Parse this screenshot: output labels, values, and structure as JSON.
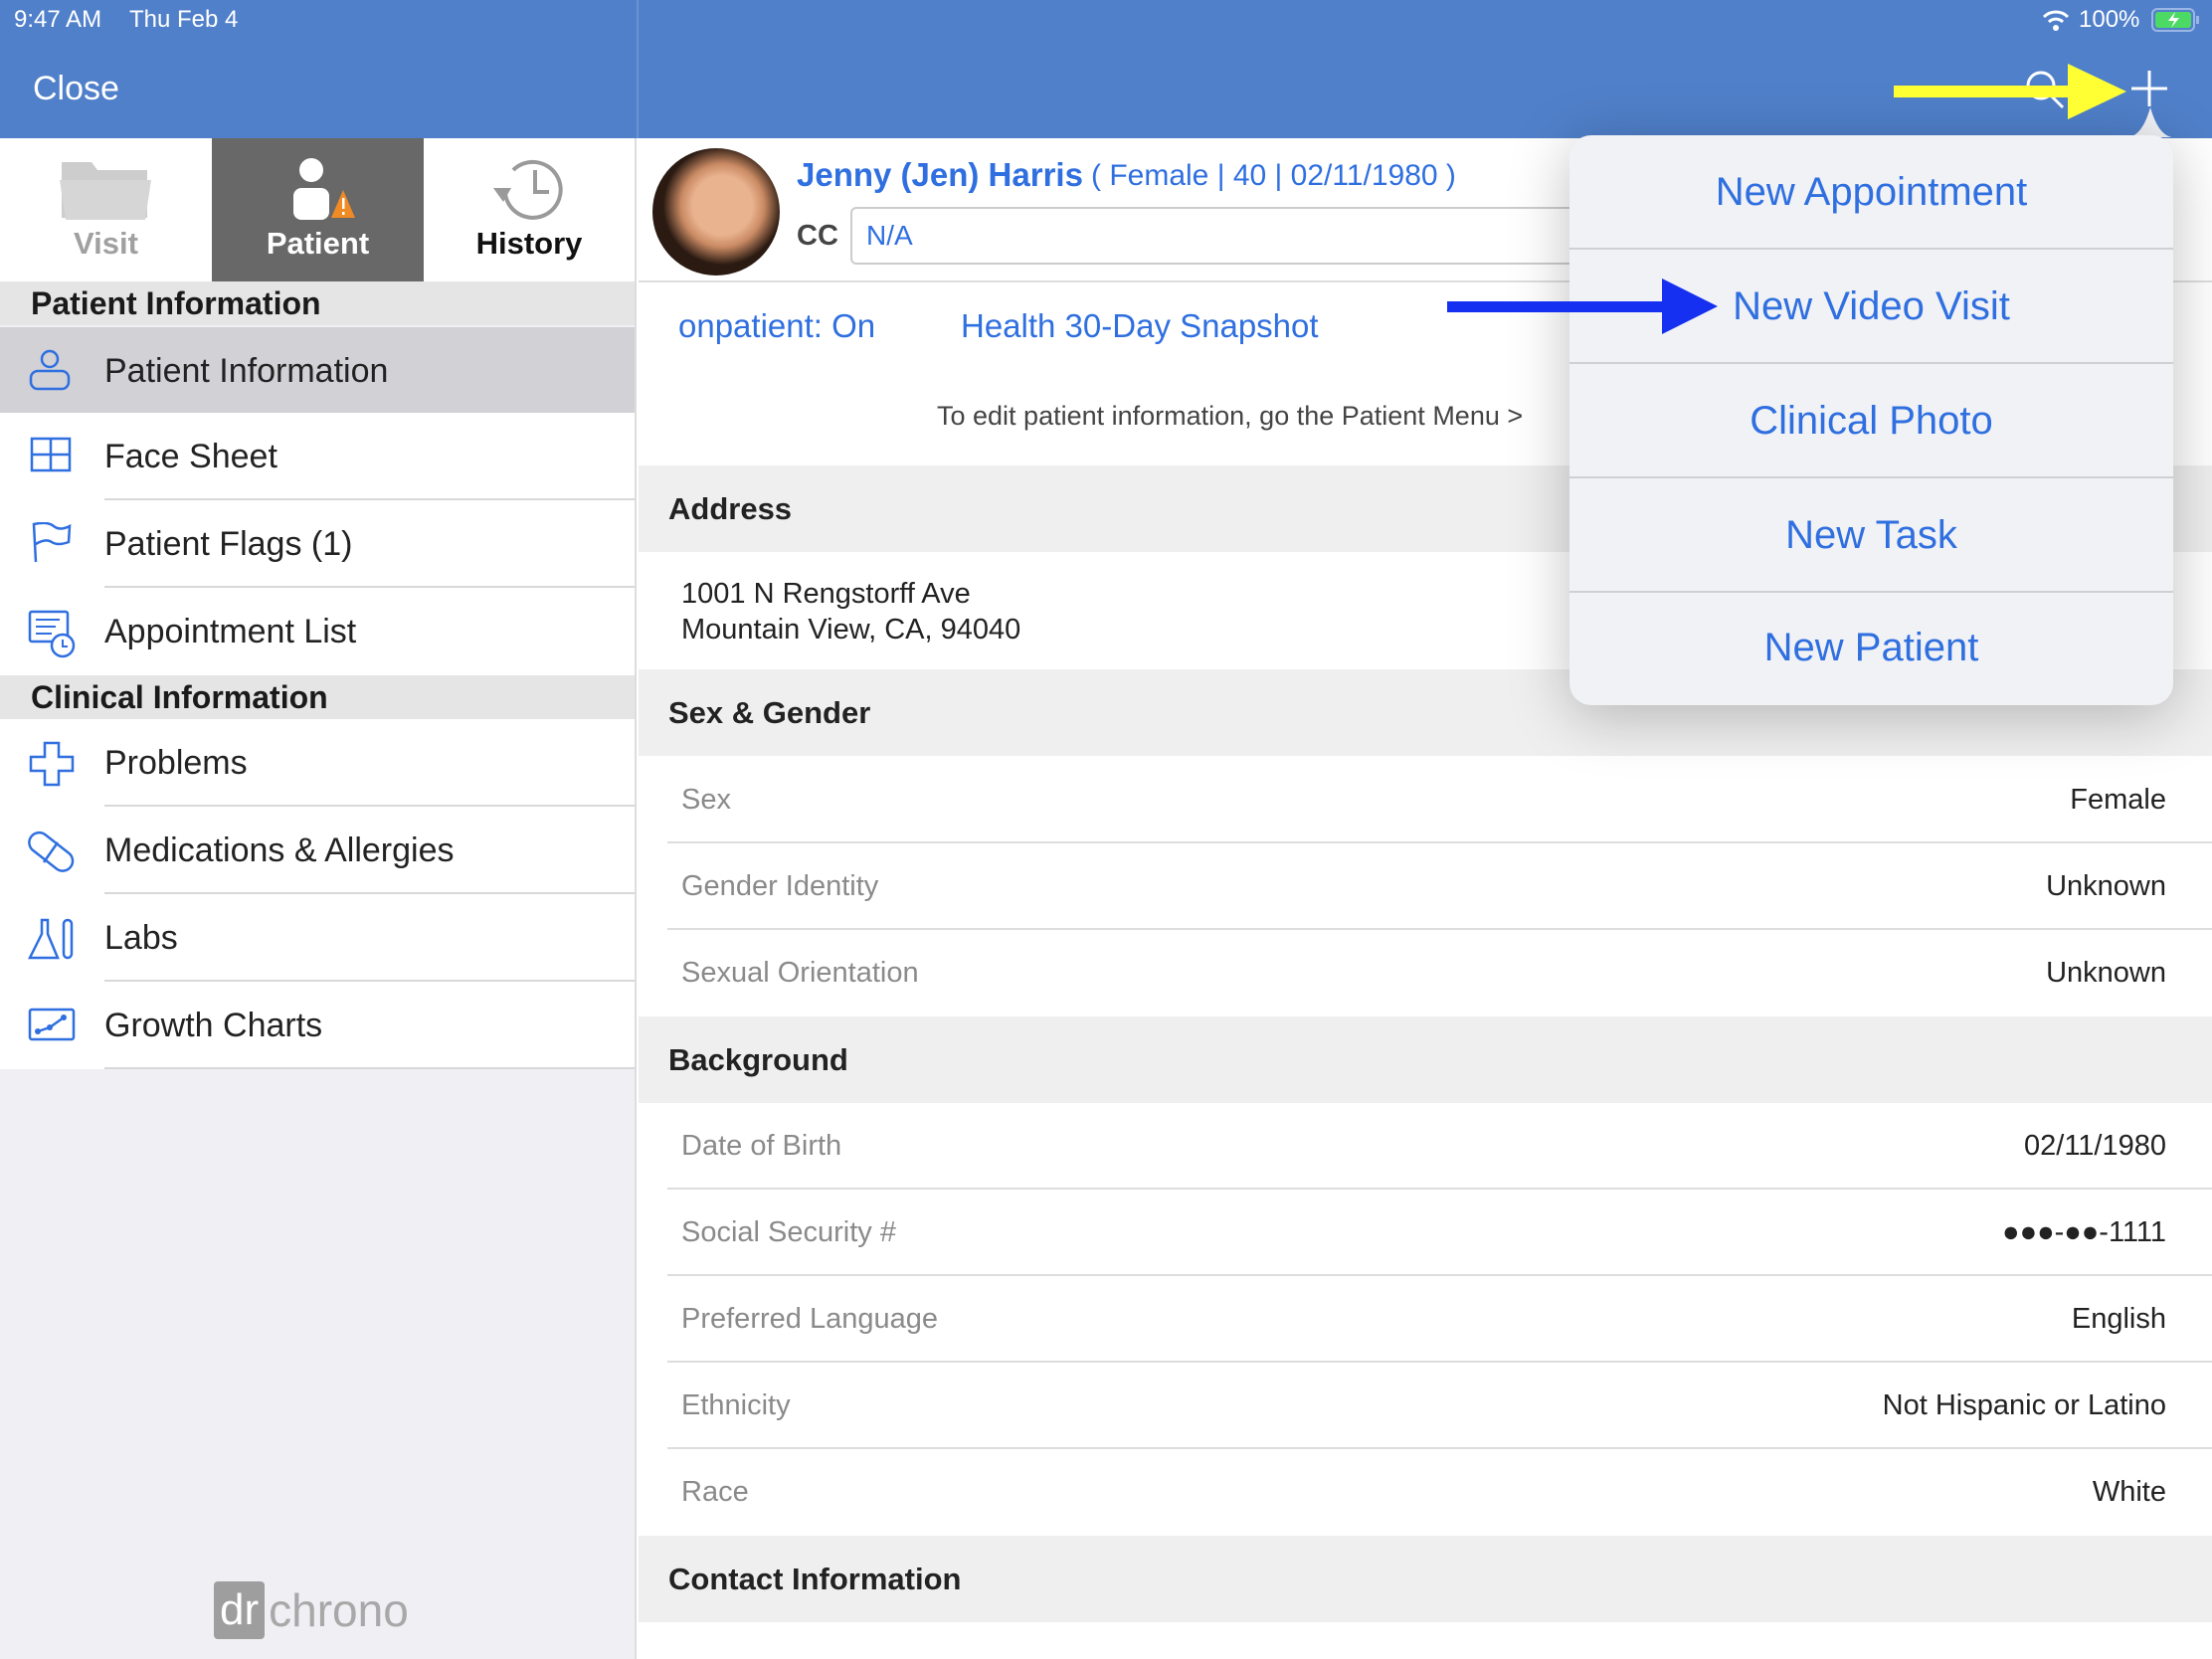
{
  "status_bar": {
    "time": "9:47 AM",
    "date": "Thu Feb 4",
    "battery": "100%"
  },
  "nav": {
    "close_label": "Close"
  },
  "tabs": [
    {
      "label": "Visit"
    },
    {
      "label": "Patient"
    },
    {
      "label": "History"
    }
  ],
  "sidebar": {
    "sections": [
      {
        "title": "Patient Information",
        "items": [
          {
            "label": "Patient Information",
            "icon": "person-icon"
          },
          {
            "label": "Face Sheet",
            "icon": "grid-icon"
          },
          {
            "label": "Patient Flags (1)",
            "icon": "flag-icon"
          },
          {
            "label": "Appointment List",
            "icon": "appointment-list-icon"
          }
        ]
      },
      {
        "title": "Clinical Information",
        "items": [
          {
            "label": "Problems",
            "icon": "cross-icon"
          },
          {
            "label": "Medications & Allergies",
            "icon": "pill-icon"
          },
          {
            "label": "Labs",
            "icon": "flask-icon"
          },
          {
            "label": "Growth Charts",
            "icon": "chart-icon"
          }
        ]
      }
    ],
    "logo": {
      "dr": "dr",
      "chrono": "chrono"
    }
  },
  "patient": {
    "name": "Jenny (Jen) Harris",
    "details": "( Female | 40 | 02/11/1980 )",
    "cc_label": "CC",
    "cc_value": "N/A"
  },
  "links": {
    "onpatient": "onpatient: On",
    "snapshot": "Health 30-Day Snapshot"
  },
  "note": "To edit patient information, go the Patient Menu >",
  "address": {
    "title": "Address",
    "line1": "1001 N Rengstorff Ave",
    "line2": "Mountain View, CA, 94040"
  },
  "sex_gender": {
    "title": "Sex & Gender",
    "rows": [
      {
        "label": "Sex",
        "value": "Female"
      },
      {
        "label": "Gender Identity",
        "value": "Unknown"
      },
      {
        "label": "Sexual Orientation",
        "value": "Unknown"
      }
    ]
  },
  "background": {
    "title": "Background",
    "rows": [
      {
        "label": "Date of Birth",
        "value": "02/11/1980"
      },
      {
        "label": "Social Security #",
        "value": "●●●-●●-1111"
      },
      {
        "label": "Preferred Language",
        "value": "English"
      },
      {
        "label": "Ethnicity",
        "value": "Not Hispanic or Latino"
      },
      {
        "label": "Race",
        "value": "White"
      }
    ]
  },
  "contact": {
    "title": "Contact Information"
  },
  "popover": {
    "items": [
      "New Appointment",
      "New Video Visit",
      "Clinical Photo",
      "New Task",
      "New Patient"
    ]
  },
  "colors": {
    "header": "#5080ca",
    "link": "#2f6fe0",
    "annotation_yellow": "#ffff33",
    "annotation_blue": "#1530f0",
    "warning": "#f08a24"
  }
}
